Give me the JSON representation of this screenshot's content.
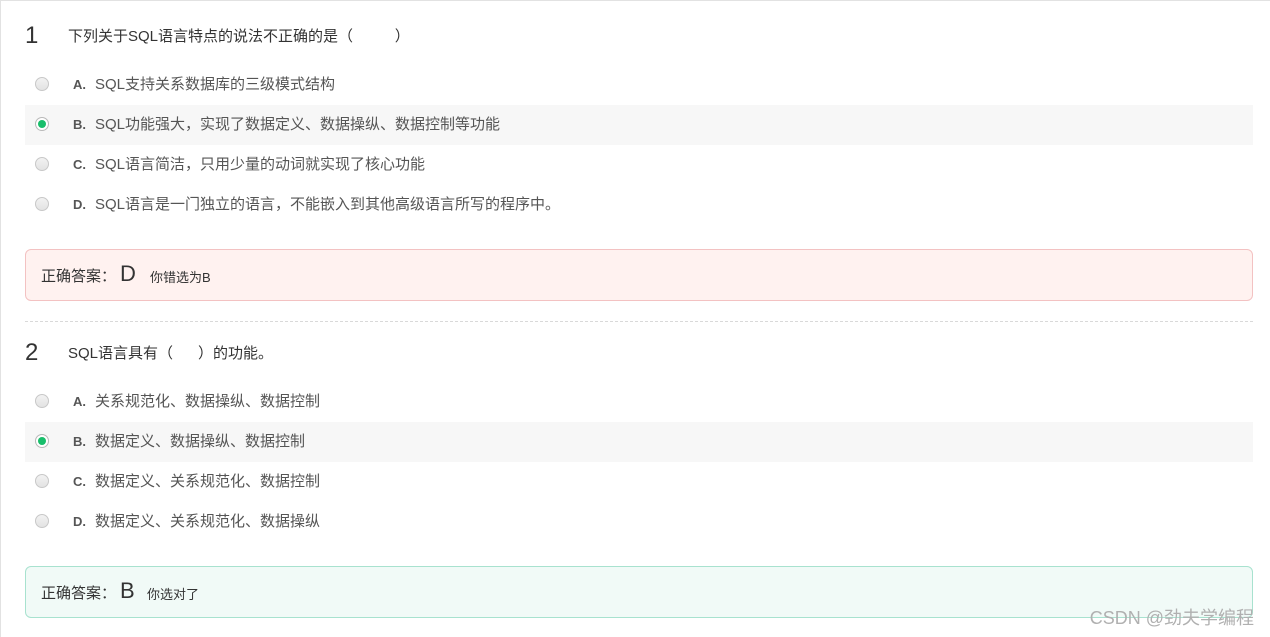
{
  "questions": [
    {
      "number": "1",
      "text": "下列关于SQL语言特点的说法不正确的是（          ）",
      "options": [
        {
          "letter": "A.",
          "text": "SQL支持关系数据库的三级模式结构",
          "selected": false
        },
        {
          "letter": "B.",
          "text": "SQL功能强大，实现了数据定义、数据操纵、数据控制等功能",
          "selected": true
        },
        {
          "letter": "C.",
          "text": "SQL语言简洁，只用少量的动词就实现了核心功能",
          "selected": false
        },
        {
          "letter": "D.",
          "text": "SQL语言是一门独立的语言，不能嵌入到其他高级语言所写的程序中。",
          "selected": false
        }
      ],
      "answer": {
        "label": "正确答案：",
        "letter": "D",
        "note": "你错选为B",
        "status": "wrong"
      }
    },
    {
      "number": "2",
      "text": "SQL语言具有（      ）的功能。",
      "options": [
        {
          "letter": "A.",
          "text": "关系规范化、数据操纵、数据控制",
          "selected": false
        },
        {
          "letter": "B.",
          "text": "数据定义、数据操纵、数据控制",
          "selected": true
        },
        {
          "letter": "C.",
          "text": "数据定义、关系规范化、数据控制",
          "selected": false
        },
        {
          "letter": "D.",
          "text": "数据定义、关系规范化、数据操纵",
          "selected": false
        }
      ],
      "answer": {
        "label": "正确答案：",
        "letter": "B",
        "note": "你选对了",
        "status": "right"
      }
    }
  ],
  "watermark": "CSDN @劲夫学编程",
  "colors": {
    "selected_radio": "#19be6b",
    "wrong_bg": "#fff2f0",
    "wrong_border": "#f3c2c2",
    "right_bg": "#f1faf7",
    "right_border": "#a8e2cf"
  }
}
